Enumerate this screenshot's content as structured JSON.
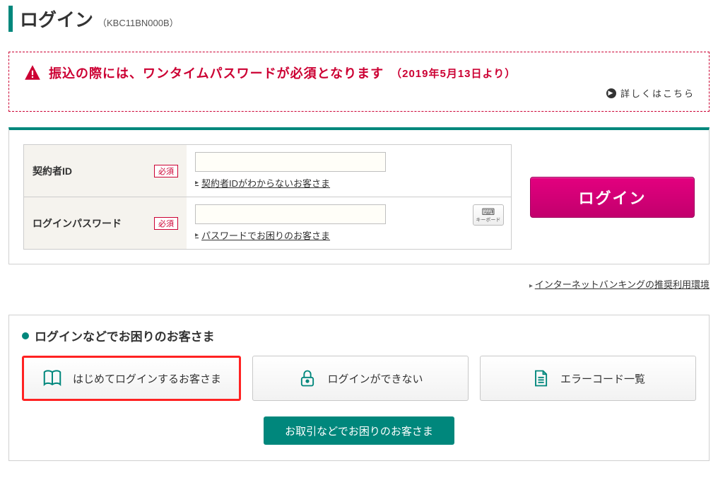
{
  "title": "ログイン",
  "code": "（KBC11BN000B）",
  "notice": {
    "message": "振込の際には、ワンタイムパスワードが必須となります",
    "date": "（2019年5月13日より）",
    "detail_link": "詳しくはこちら"
  },
  "form": {
    "id_label": "契約者ID",
    "id_help": "契約者IDがわからないお客さま",
    "pw_label": "ログインパスワード",
    "pw_help": "パスワードでお困りのお客さま",
    "required": "必須",
    "keyboard_label": "キーボード",
    "login_btn": "ログイン"
  },
  "env_link": "インターネットバンキングの推奨利用環境",
  "help": {
    "heading": "ログインなどでお困りのお客さま",
    "cards": [
      "はじめてログインするお客さま",
      "ログインができない",
      "エラーコード一覧"
    ],
    "more_btn": "お取引などでお困りのお客さま"
  }
}
